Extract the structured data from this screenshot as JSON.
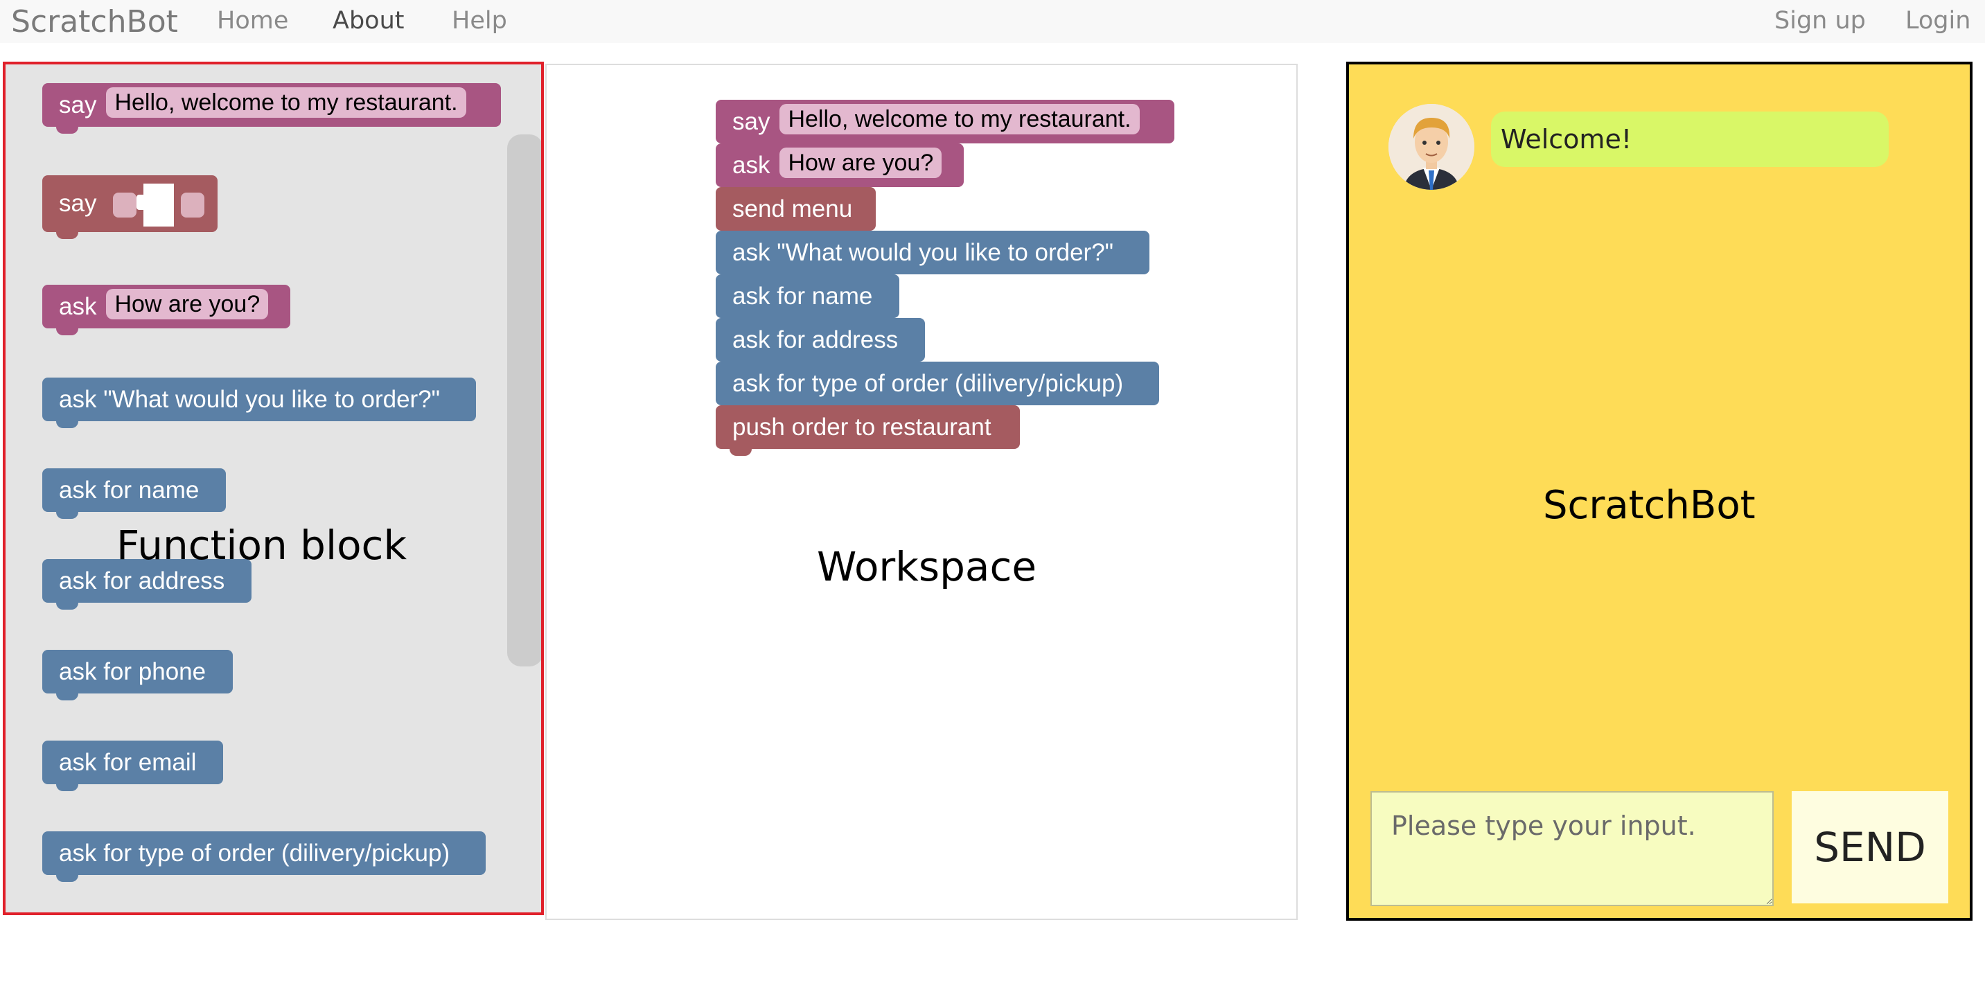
{
  "navbar": {
    "brand": "ScratchBot",
    "links": [
      "Home",
      "About",
      "Help"
    ],
    "right_links": [
      "Sign up",
      "Login"
    ]
  },
  "toolbox": {
    "label": "Function block",
    "blocks": [
      {
        "keyword": "say",
        "field": "Hello, welcome to my restaurant.",
        "color": "#a85582"
      },
      {
        "keyword": "say",
        "color": "#a55b60"
      },
      {
        "keyword": "ask",
        "field": "How are you?",
        "color": "#a85582"
      },
      {
        "text": "ask \"What would you like to order?\"",
        "color": "#5b80a6"
      },
      {
        "text": "ask for name",
        "color": "#5b80a6"
      },
      {
        "text": "ask for address",
        "color": "#5b80a6"
      },
      {
        "text": "ask for phone",
        "color": "#5b80a6"
      },
      {
        "text": "ask for email",
        "color": "#5b80a6"
      },
      {
        "text": "ask for type of order (dilivery/pickup)",
        "color": "#5b80a6"
      }
    ]
  },
  "workspace": {
    "label": "Workspace",
    "blocks": [
      {
        "keyword": "say",
        "field": "Hello, welcome to my restaurant."
      },
      {
        "keyword": "ask",
        "field": "How are you?"
      },
      {
        "text": "send menu"
      },
      {
        "text": "ask \"What would you like to order?\""
      },
      {
        "text": "ask for name"
      },
      {
        "text": "ask for address"
      },
      {
        "text": "ask for type of order (dilivery/pickup)"
      },
      {
        "text": "push order to restaurant"
      }
    ]
  },
  "chat": {
    "title": "ScratchBot",
    "messages": [
      {
        "from": "bot",
        "text": "Welcome!"
      }
    ],
    "input_placeholder": "Please type your input.",
    "send_label": "SEND",
    "background": "#fedc57"
  }
}
